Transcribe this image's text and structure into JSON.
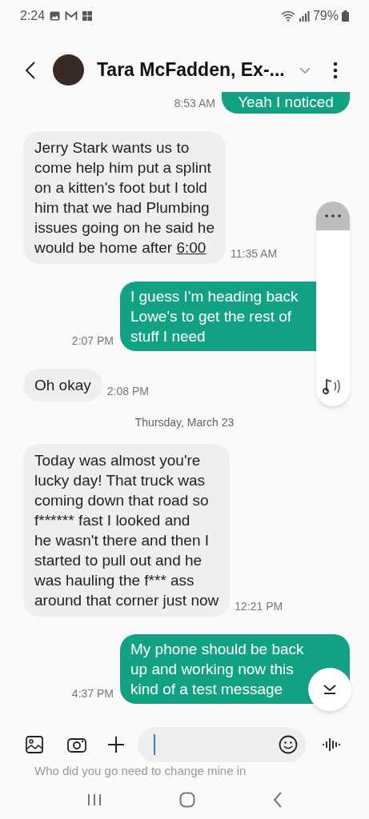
{
  "status_bar": {
    "time": "2:24",
    "battery": "79%"
  },
  "header": {
    "title": "Tara McFadden, Ex-..."
  },
  "messages": [
    {
      "kind": "sent",
      "text": "Yeah I noticed",
      "time": "8:53 AM"
    },
    {
      "kind": "received",
      "text": "Jerry Stark wants us to\ncome help him put a splint\non a kitten's foot but I told\nhim that we had Plumbing\nissues going on he said he\nwould be home after",
      "link": "6:00",
      "time": "11:35 AM"
    },
    {
      "kind": "sent",
      "text": "I guess I'm heading back\nLowe's to get the rest of\nstuff I need",
      "time": "2:07 PM"
    },
    {
      "kind": "received",
      "text": "Oh okay",
      "time": "2:08 PM"
    },
    {
      "kind": "date",
      "text": "Thursday, March 23"
    },
    {
      "kind": "received",
      "text": "Today was almost you're\nlucky day! That truck was\ncoming down that road so\nf****** fast I looked and\nhe wasn't there and then I\nstarted to pull out and he\nwas hauling the f*** ass\naround that corner just now",
      "time": "12:21 PM"
    },
    {
      "kind": "sent",
      "text": "My phone should be back\nup and working now this\nkind of a test message",
      "time": "4:37 PM"
    }
  ],
  "draft_preview": "Who did you go\nneed to change mine in"
}
